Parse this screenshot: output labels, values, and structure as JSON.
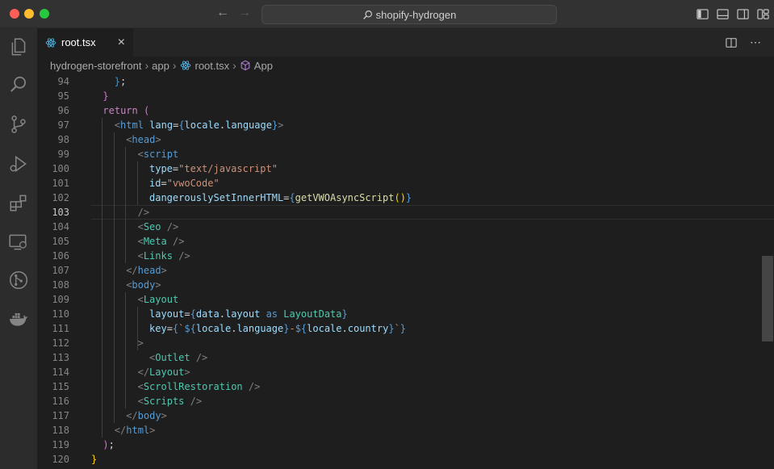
{
  "window": {
    "search_text": "shopify-hydrogen"
  },
  "tab": {
    "label": "root.tsx",
    "close": "×"
  },
  "breadcrumb": [
    "hydrogen-storefront",
    "app",
    "root.tsx",
    "App"
  ],
  "editor": {
    "current_line": "103",
    "lines": [
      {
        "n": "94",
        "t": [
          [
            "br3",
            "}"
          ],
          [
            "plain",
            ";"
          ]
        ]
      },
      {
        "n": "95",
        "t": [
          [
            "br2",
            "}"
          ]
        ]
      },
      {
        "n": "96",
        "t": [
          [
            "kw",
            "return"
          ],
          [
            "plain",
            " "
          ],
          [
            "br2",
            "("
          ]
        ]
      },
      {
        "n": "97",
        "t": [
          [
            "punc",
            "<"
          ],
          [
            "tag",
            "html"
          ],
          [
            "plain",
            " "
          ],
          [
            "attr",
            "lang"
          ],
          [
            "plain",
            "="
          ],
          [
            "tag",
            "{"
          ],
          [
            "var",
            "locale"
          ],
          [
            "plain",
            "."
          ],
          [
            "var",
            "language"
          ],
          [
            "tag",
            "}"
          ],
          [
            "punc",
            ">"
          ]
        ]
      },
      {
        "n": "98",
        "t": [
          [
            "punc",
            "<"
          ],
          [
            "tag",
            "head"
          ],
          [
            "punc",
            ">"
          ]
        ]
      },
      {
        "n": "99",
        "t": [
          [
            "punc",
            "<"
          ],
          [
            "tag",
            "script"
          ]
        ]
      },
      {
        "n": "100",
        "t": [
          [
            "attr",
            "type"
          ],
          [
            "plain",
            "="
          ],
          [
            "str",
            "\"text/javascript\""
          ]
        ]
      },
      {
        "n": "101",
        "t": [
          [
            "attr",
            "id"
          ],
          [
            "plain",
            "="
          ],
          [
            "str",
            "\"vwoCode\""
          ]
        ]
      },
      {
        "n": "102",
        "t": [
          [
            "attr",
            "dangerouslySetInnerHTML"
          ],
          [
            "plain",
            "="
          ],
          [
            "tag",
            "{"
          ],
          [
            "fn",
            "getVWOAsyncScript"
          ],
          [
            "br1",
            "()"
          ],
          [
            "tag",
            "}"
          ]
        ]
      },
      {
        "n": "103",
        "t": [
          [
            "punc",
            "/>"
          ]
        ]
      },
      {
        "n": "104",
        "t": [
          [
            "punc",
            "<"
          ],
          [
            "cmp",
            "Seo"
          ],
          [
            "plain",
            " "
          ],
          [
            "punc",
            "/>"
          ]
        ]
      },
      {
        "n": "105",
        "t": [
          [
            "punc",
            "<"
          ],
          [
            "cmp",
            "Meta"
          ],
          [
            "plain",
            " "
          ],
          [
            "punc",
            "/>"
          ]
        ]
      },
      {
        "n": "106",
        "t": [
          [
            "punc",
            "<"
          ],
          [
            "cmp",
            "Links"
          ],
          [
            "plain",
            " "
          ],
          [
            "punc",
            "/>"
          ]
        ]
      },
      {
        "n": "107",
        "t": [
          [
            "punc",
            "</"
          ],
          [
            "tag",
            "head"
          ],
          [
            "punc",
            ">"
          ]
        ]
      },
      {
        "n": "108",
        "t": [
          [
            "punc",
            "<"
          ],
          [
            "tag",
            "body"
          ],
          [
            "punc",
            ">"
          ]
        ]
      },
      {
        "n": "109",
        "t": [
          [
            "punc",
            "<"
          ],
          [
            "cmp",
            "Layout"
          ]
        ]
      },
      {
        "n": "110",
        "t": [
          [
            "attr",
            "layout"
          ],
          [
            "plain",
            "="
          ],
          [
            "tag",
            "{"
          ],
          [
            "var",
            "data"
          ],
          [
            "plain",
            "."
          ],
          [
            "var",
            "layout"
          ],
          [
            "plain",
            " "
          ],
          [
            "tag",
            "as"
          ],
          [
            "plain",
            " "
          ],
          [
            "cmp",
            "LayoutData"
          ],
          [
            "tag",
            "}"
          ]
        ]
      },
      {
        "n": "111",
        "t": [
          [
            "attr",
            "key"
          ],
          [
            "plain",
            "="
          ],
          [
            "tag",
            "{"
          ],
          [
            "str",
            "`"
          ],
          [
            "tag",
            "${"
          ],
          [
            "var",
            "locale"
          ],
          [
            "plain",
            "."
          ],
          [
            "var",
            "language"
          ],
          [
            "tag",
            "}"
          ],
          [
            "str",
            "-"
          ],
          [
            "tag",
            "${"
          ],
          [
            "var",
            "locale"
          ],
          [
            "plain",
            "."
          ],
          [
            "var",
            "country"
          ],
          [
            "tag",
            "}"
          ],
          [
            "str",
            "`"
          ],
          [
            "tag",
            "}"
          ]
        ]
      },
      {
        "n": "112",
        "t": [
          [
            "punc",
            ">"
          ]
        ]
      },
      {
        "n": "113",
        "t": [
          [
            "punc",
            "<"
          ],
          [
            "cmp",
            "Outlet"
          ],
          [
            "plain",
            " "
          ],
          [
            "punc",
            "/>"
          ]
        ]
      },
      {
        "n": "114",
        "t": [
          [
            "punc",
            "</"
          ],
          [
            "cmp",
            "Layout"
          ],
          [
            "punc",
            ">"
          ]
        ]
      },
      {
        "n": "115",
        "t": [
          [
            "punc",
            "<"
          ],
          [
            "cmp",
            "ScrollRestoration"
          ],
          [
            "plain",
            " "
          ],
          [
            "punc",
            "/>"
          ]
        ]
      },
      {
        "n": "116",
        "t": [
          [
            "punc",
            "<"
          ],
          [
            "cmp",
            "Scripts"
          ],
          [
            "plain",
            " "
          ],
          [
            "punc",
            "/>"
          ]
        ]
      },
      {
        "n": "117",
        "t": [
          [
            "punc",
            "</"
          ],
          [
            "tag",
            "body"
          ],
          [
            "punc",
            ">"
          ]
        ]
      },
      {
        "n": "118",
        "t": [
          [
            "punc",
            "</"
          ],
          [
            "tag",
            "html"
          ],
          [
            "punc",
            ">"
          ]
        ]
      },
      {
        "n": "119",
        "t": [
          [
            "br2",
            ")"
          ],
          [
            "plain",
            ";"
          ]
        ]
      },
      {
        "n": "120",
        "t": [
          [
            "br1",
            "}"
          ]
        ]
      }
    ]
  }
}
